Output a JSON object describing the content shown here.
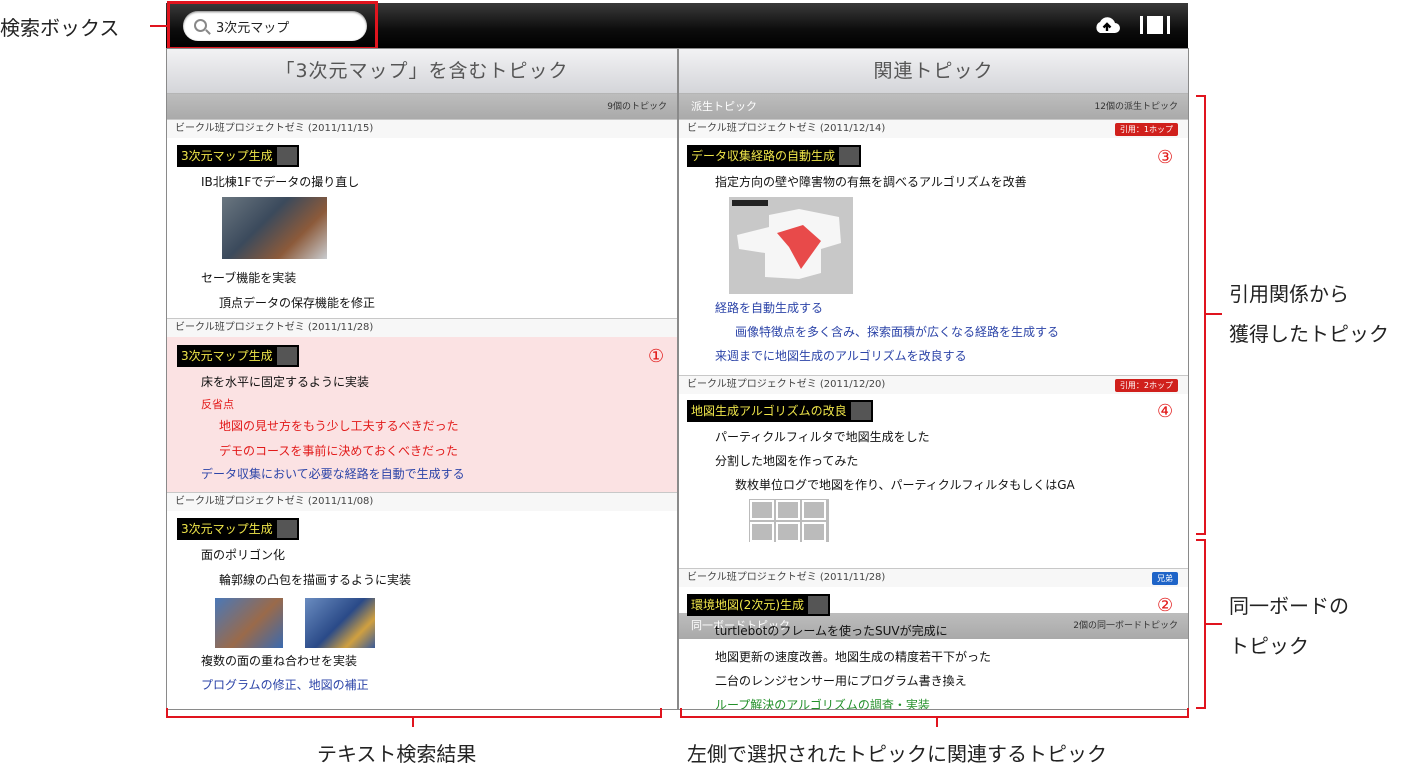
{
  "search": {
    "query": "3次元マップ"
  },
  "left": {
    "header": "「3次元マップ」を含むトピック",
    "count": "9個のトピック",
    "items": [
      {
        "date": "ビークル班プロジェクトゼミ (2011/11/15)",
        "title": "3次元マップ生成",
        "lines": [
          "IB北棟1Fでデータの撮り直し",
          "セーブ機能を実装",
          "頂点データの保存機能を修正"
        ]
      },
      {
        "date": "ビークル班プロジェクトゼミ (2011/11/28)",
        "title": "3次元マップ生成",
        "marker": "①",
        "lines": [
          "床を水平に固定するように実装",
          "反省点",
          "地図の見せ方をもう少し工夫するべきだった",
          "デモのコースを事前に決めておくべきだった",
          "データ収集において必要な経路を自動で生成する"
        ]
      },
      {
        "date": "ビークル班プロジェクトゼミ (2011/11/08)",
        "title": "3次元マップ生成",
        "lines": [
          "面のポリゴン化",
          "輪郭線の凸包を描画するように実装",
          "複数の面の重ね合わせを実装",
          "プログラムの修正、地図の補正"
        ]
      }
    ]
  },
  "right": {
    "header": "関連トピック",
    "derived": {
      "label": "派生トピック",
      "count": "12個の派生トピック"
    },
    "items": [
      {
        "date": "ビークル班プロジェクトゼミ (2011/12/14)",
        "badge": "引用：1ホップ",
        "title": "データ収集経路の自動生成",
        "marker": "③",
        "lines": [
          "指定方向の壁や障害物の有無を調べるアルゴリズムを改善",
          "経路を自動生成する",
          "画像特徴点を多く含み、探索面積が広くなる経路を生成する",
          "来週までに地図生成のアルゴリズムを改良する"
        ]
      },
      {
        "date": "ビークル班プロジェクトゼミ (2011/12/20)",
        "badge": "引用：2ホップ",
        "title": "地図生成アルゴリズムの改良",
        "marker": "④",
        "lines": [
          "パーティクルフィルタで地図生成をした",
          "分割した地図を作ってみた",
          "数枚単位ログで地図を作り、パーティクルフィルタもしくはGA"
        ]
      }
    ],
    "sameboard": {
      "label": "同一ボードトピック",
      "count": "2個の同一ボードトピック"
    },
    "board_item": {
      "date": "ビークル班プロジェクトゼミ (2011/11/28)",
      "badge": "兄弟",
      "title": "環境地図(2次元)生成",
      "marker": "②",
      "lines": [
        "turtlebotのフレームを使ったSUVが完成に",
        "地図更新の速度改善。地図生成の精度若干下がった",
        "二台のレンジセンサー用にプログラム書き換え",
        "ループ解決のアルゴリズムの調査・実装"
      ]
    }
  },
  "annotations": {
    "search_box": "検索ボックス",
    "citation_line1": "引用関係から",
    "citation_line2": "獲得したトピック",
    "sameboard_line1": "同一ボードの",
    "sameboard_line2": "トピック",
    "left_caption": "テキスト検索結果",
    "right_caption": "左側で選択されたトピックに関連するトピック"
  }
}
